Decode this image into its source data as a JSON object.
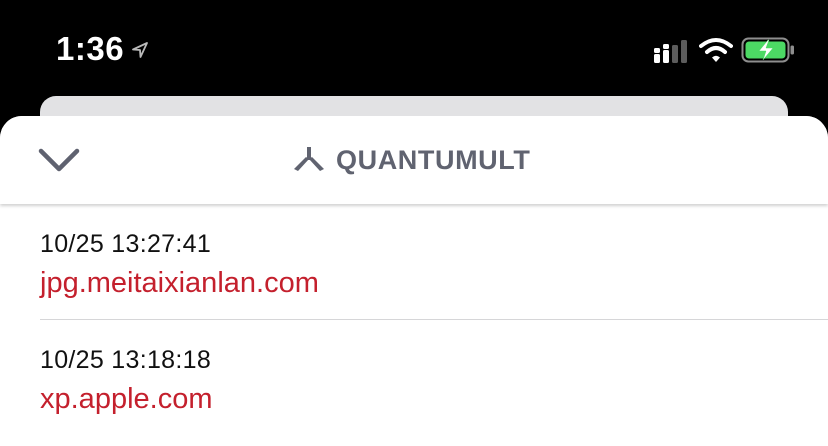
{
  "status_bar": {
    "time": "1:36",
    "icons": [
      "location-arrow-icon",
      "cellular-signal-icon",
      "wifi-icon",
      "battery-charging-icon"
    ],
    "battery_color": "#4cd964"
  },
  "header": {
    "app_name": "QUANTUMULT",
    "icons": [
      "chevron-down-icon",
      "quantumult-logo-icon"
    ]
  },
  "requests": [
    {
      "time": "10/25 13:27:41",
      "host": "jpg.meitaixianlan.com"
    },
    {
      "time": "10/25 13:18:18",
      "host": "xp.apple.com"
    }
  ],
  "colors": {
    "host_text": "#c4202d",
    "brand_text": "#606370"
  }
}
